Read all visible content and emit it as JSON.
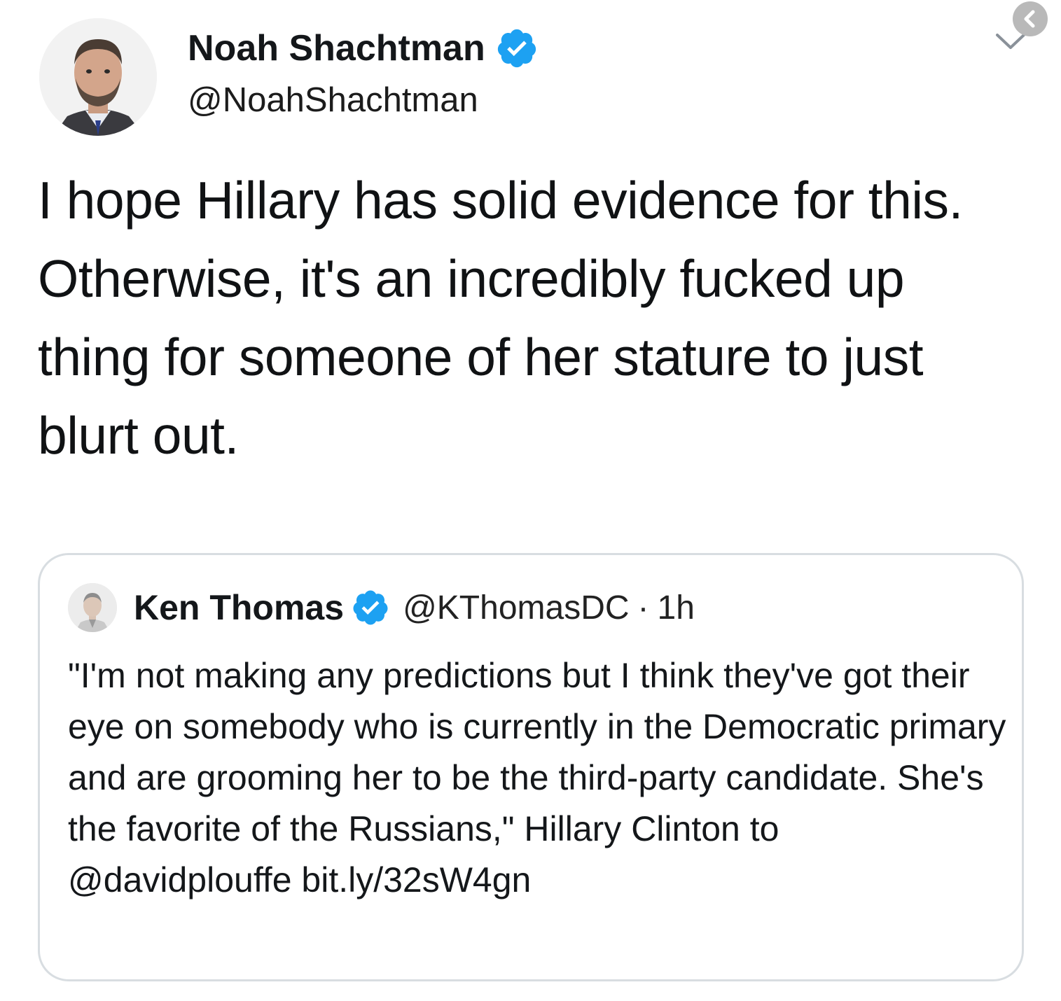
{
  "tweet": {
    "author": {
      "display_name": "Noah Shachtman",
      "handle": "@NoahShachtman",
      "verified": true,
      "avatar_icon": "profile-photo"
    },
    "text": "I hope Hillary has solid evidence for this. Otherwise, it's an incredibly fucked up thing for someone of her stature to just blurt out.",
    "menu_icon": "chevron-down-icon"
  },
  "quoted_tweet": {
    "author": {
      "display_name": "Ken Thomas",
      "handle": "@KThomasDC",
      "verified": true
    },
    "separator": "·",
    "time": "1h",
    "text": "\"I'm not making any predictions but I think they've got their eye on somebody who is currently in the Democratic primary and are grooming her to be the third-party candidate. She's the favorite of the Russians,\" Hillary Clinton to @davidplouffe bit.ly/32sW4gn"
  },
  "colors": {
    "verified_blue": "#1da1f2",
    "card_border": "#d8dde1",
    "text": "#14171a"
  },
  "overlay": {
    "back_icon": "chevron-left-icon"
  }
}
